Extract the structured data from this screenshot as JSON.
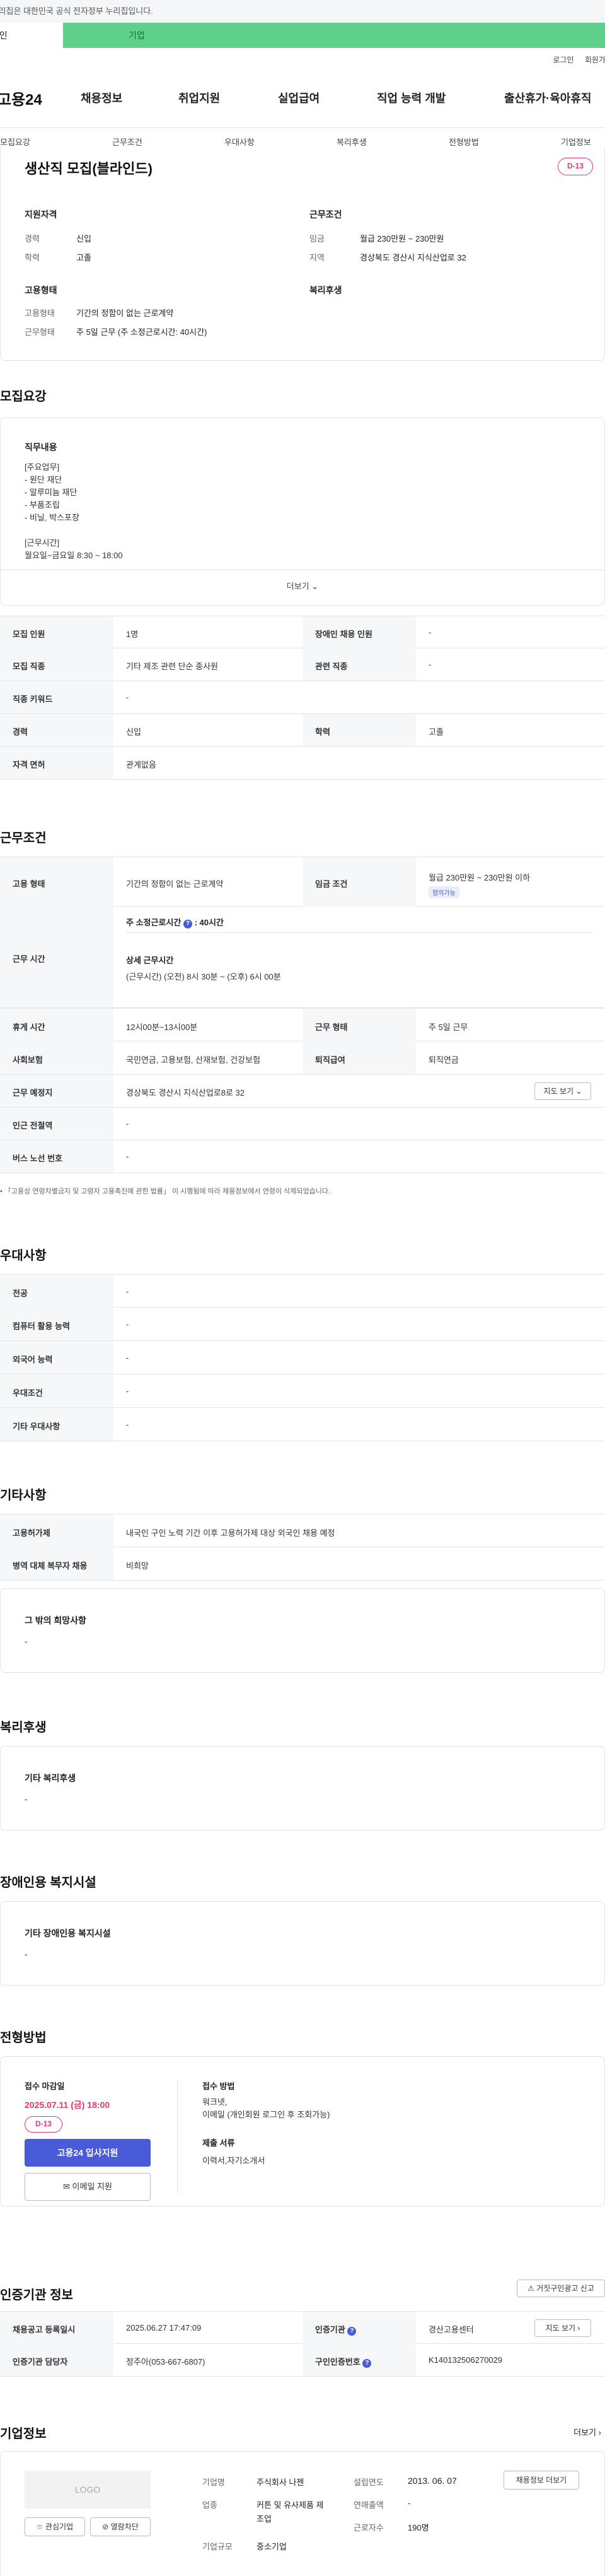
{
  "gov_banner": "이 누리집은 대한민국 공식 전자정부 누리집입니다.",
  "tabs": {
    "individual": "개인",
    "company": "기업"
  },
  "util": {
    "login": "로그인",
    "join": "회원가입"
  },
  "logo": "고용24",
  "gnb": [
    "채용정보",
    "취업지원",
    "실업급여",
    "직업 능력 개발",
    "출산휴가·육아휴직"
  ],
  "lnb": [
    "모집요강",
    "근무조건",
    "우대사항",
    "복리후생",
    "전형방법",
    "기업정보"
  ],
  "job": {
    "title": "생산직 모집(블라인드)",
    "dday": "D-13",
    "qual_title": "지원자격",
    "career_l": "경력",
    "career_v": "신입",
    "edu_l": "학력",
    "edu_v": "고졸",
    "cond_title": "근무조건",
    "wage_l": "임금",
    "wage_v": "월급 230만원 ~ 230만원",
    "region_l": "지역",
    "region_v": "경상북도 경산시 지식산업로 32",
    "emp_title": "고용형태",
    "emptype_l": "고용형태",
    "emptype_v": "기간의 정함이 없는 근로계약",
    "worktype_l": "근무형태",
    "worktype_v": "주 5일 근무 (주 소정근로시간: 40시간)",
    "welfare_title": "복리후생"
  },
  "recruit": {
    "title": "모집요강",
    "duty_title": "직무내용",
    "duty_text": "[주요업무]\n- 원단 재단\n- 알루미늄 재단\n- 부품조립\n- 비닐, 박스포장\n\n[근무시간]\n월요일~금요일 8:30 ~ 18:00",
    "more": "더보기",
    "rows": [
      [
        "모집 인원",
        "1명",
        "장애인 채용 인원",
        "-"
      ],
      [
        "모집 직종",
        "기타 제조 관련 단순 종사원",
        "관련 직종",
        "-"
      ],
      [
        "직종 키워드",
        "-",
        "",
        ""
      ],
      [
        "경력",
        "신입",
        "학력",
        "고졸"
      ],
      [
        "자격 면허",
        "관계없음",
        "",
        ""
      ]
    ]
  },
  "workcond": {
    "title": "근무조건",
    "emp_l": "고용 형태",
    "emp_v": "기간의 정함이 없는 근로계약",
    "wage_l": "임금 조건",
    "wage_v": "월급 230만원 ~ 230만원 이하",
    "wage_tag": "협의가능",
    "hours_l": "근무 시간",
    "weekly": "주 소정근로시간",
    "weekly_v": ": 40시간",
    "detail_title": "상세 근무시간",
    "detail_v": "(근무시간) (오전) 8시 30분 ~ (오후) 6시 00분",
    "rows": [
      [
        "휴게 시간",
        "12시00분~13시00분",
        "근무 형태",
        "주 5일 근무"
      ],
      [
        "사회보험",
        "국민연금, 고용보험, 산재보험, 건강보험",
        "퇴직급여",
        "퇴직연금"
      ]
    ],
    "place_l": "근무 예정지",
    "place_v": "경상북도 경산시 지식산업로8로 32",
    "map_btn": "지도 보기",
    "station_l": "인근 전철역",
    "station_v": "-",
    "bus_l": "버스 노선 번호",
    "bus_v": "-",
    "note": "「고용상 연령차별금지 및 고령자 고용촉진에 관한 법률」 이 시행됨에 따라 채용정보에서 연령이 삭제되었습니다."
  },
  "pref": {
    "title": "우대사항",
    "rows": [
      [
        "전공",
        "-"
      ],
      [
        "컴퓨터 활용 능력",
        "-"
      ],
      [
        "외국어 능력",
        "-"
      ],
      [
        "우대조건",
        "-"
      ],
      [
        "기타 우대사항",
        "-"
      ]
    ]
  },
  "etc": {
    "title": "기타사항",
    "rows": [
      [
        "고용허가제",
        "내국인 구인 노력 기간 이후 고용허가제 대상 외국인 채용 예정"
      ],
      [
        "병역 대체 복무자 채용",
        "비희망"
      ]
    ],
    "other_title": "그 밖의 희망사항",
    "other_v": "-"
  },
  "benefit": {
    "title": "복리후생",
    "sub": "기타 복리후생",
    "v": "-"
  },
  "disab": {
    "title": "장애인용 복지시설",
    "sub": "기타 장애인용 복지시설",
    "v": "-"
  },
  "apply": {
    "title": "전형방법",
    "deadline_l": "접수 마감일",
    "deadline_v": "2025.07.11 (금) 18:00",
    "dday": "D-13",
    "apply_btn": "고용24 입사지원",
    "email_btn": "이메일 지원",
    "method_l": "접수 방법",
    "method_v": "워크넷,\n이메일 (개인회원 로그인 후 조회가능)",
    "docs_l": "제출 서류",
    "docs_v": "이력서,자기소개서"
  },
  "agency": {
    "title": "인증기관 정보",
    "report_btn": "거짓구인광고 신고",
    "reg_l": "채용공고 등록일시",
    "reg_v": "2025.06.27 17:47:09",
    "org_l": "인증기관",
    "org_v": "경산고용센터",
    "map_btn": "지도 보기",
    "mgr_l": "인증기관 담당자",
    "mgr_v": "정주아(053-667-6807)",
    "no_l": "구인인증번호",
    "no_v": "K140132506270029"
  },
  "company": {
    "title": "기업정보",
    "more": "더보기",
    "logo": "LOGO",
    "fav": "관심기업",
    "block": "열람차단",
    "jobs_btn": "채용정보 더보기",
    "name_l": "기업명",
    "name_v": "주식회사 나젠",
    "ind_l": "업종",
    "ind_v": "커튼 및 유사제품 제조업",
    "size_l": "기업규모",
    "size_v": "중소기업",
    "est_l": "설립연도",
    "est_v": "2013. 06. 07",
    "sales_l": "연매출액",
    "sales_v": "-",
    "emp_l": "근로자수",
    "emp_v": "190명"
  },
  "colors": {
    "accent": "#4a5bd9",
    "dday": "#e6376c",
    "company_tab": "#5fd08a"
  }
}
